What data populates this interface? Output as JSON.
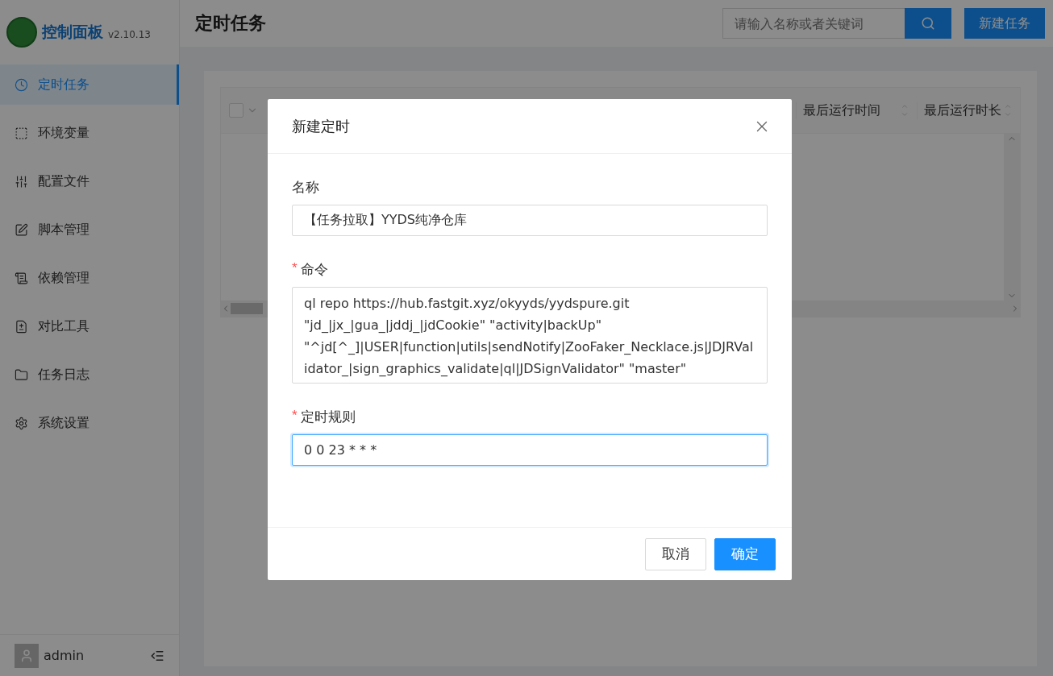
{
  "sidebar": {
    "logo_title": "控制面板",
    "version": "v2.10.13",
    "items": [
      {
        "label": "定时任务",
        "selected": true
      },
      {
        "label": "环境变量",
        "selected": false
      },
      {
        "label": "配置文件",
        "selected": false
      },
      {
        "label": "脚本管理",
        "selected": false
      },
      {
        "label": "依赖管理",
        "selected": false
      },
      {
        "label": "对比工具",
        "selected": false
      },
      {
        "label": "任务日志",
        "selected": false
      },
      {
        "label": "系统设置",
        "selected": false
      }
    ],
    "user": "admin"
  },
  "header": {
    "title": "定时任务",
    "search": {
      "placeholder": "请输入名称或者关键词"
    },
    "new_button": "新建任务"
  },
  "table": {
    "select_all_checked": false,
    "columns": [
      "最后运行时间",
      "最后运行时长"
    ]
  },
  "dialog": {
    "title": "新建定时",
    "fields": [
      {
        "kind": "input",
        "label": "名称",
        "focused": false,
        "value": "【任务拉取】YYDS纯净仓库"
      },
      {
        "kind": "textarea",
        "required_mark": "*",
        "label": "命令",
        "focused": false,
        "value": "ql repo https://hub.fastgit.xyz/okyyds/yydspure.git \"jd_|jx_|gua_|jddj_|jdCookie\" \"activity|backUp\" \"^jd[^_]|USER|function|utils|sendNotify|ZooFaker_Necklace.js|JDJRValidator_|sign_graphics_validate|ql|JDSignValidator\" \"master\""
      },
      {
        "kind": "input",
        "required_mark": "*",
        "label": "定时规则",
        "focused": true,
        "value": "0 0 23 * * *"
      }
    ],
    "cancel": "取消",
    "ok": "确定"
  }
}
